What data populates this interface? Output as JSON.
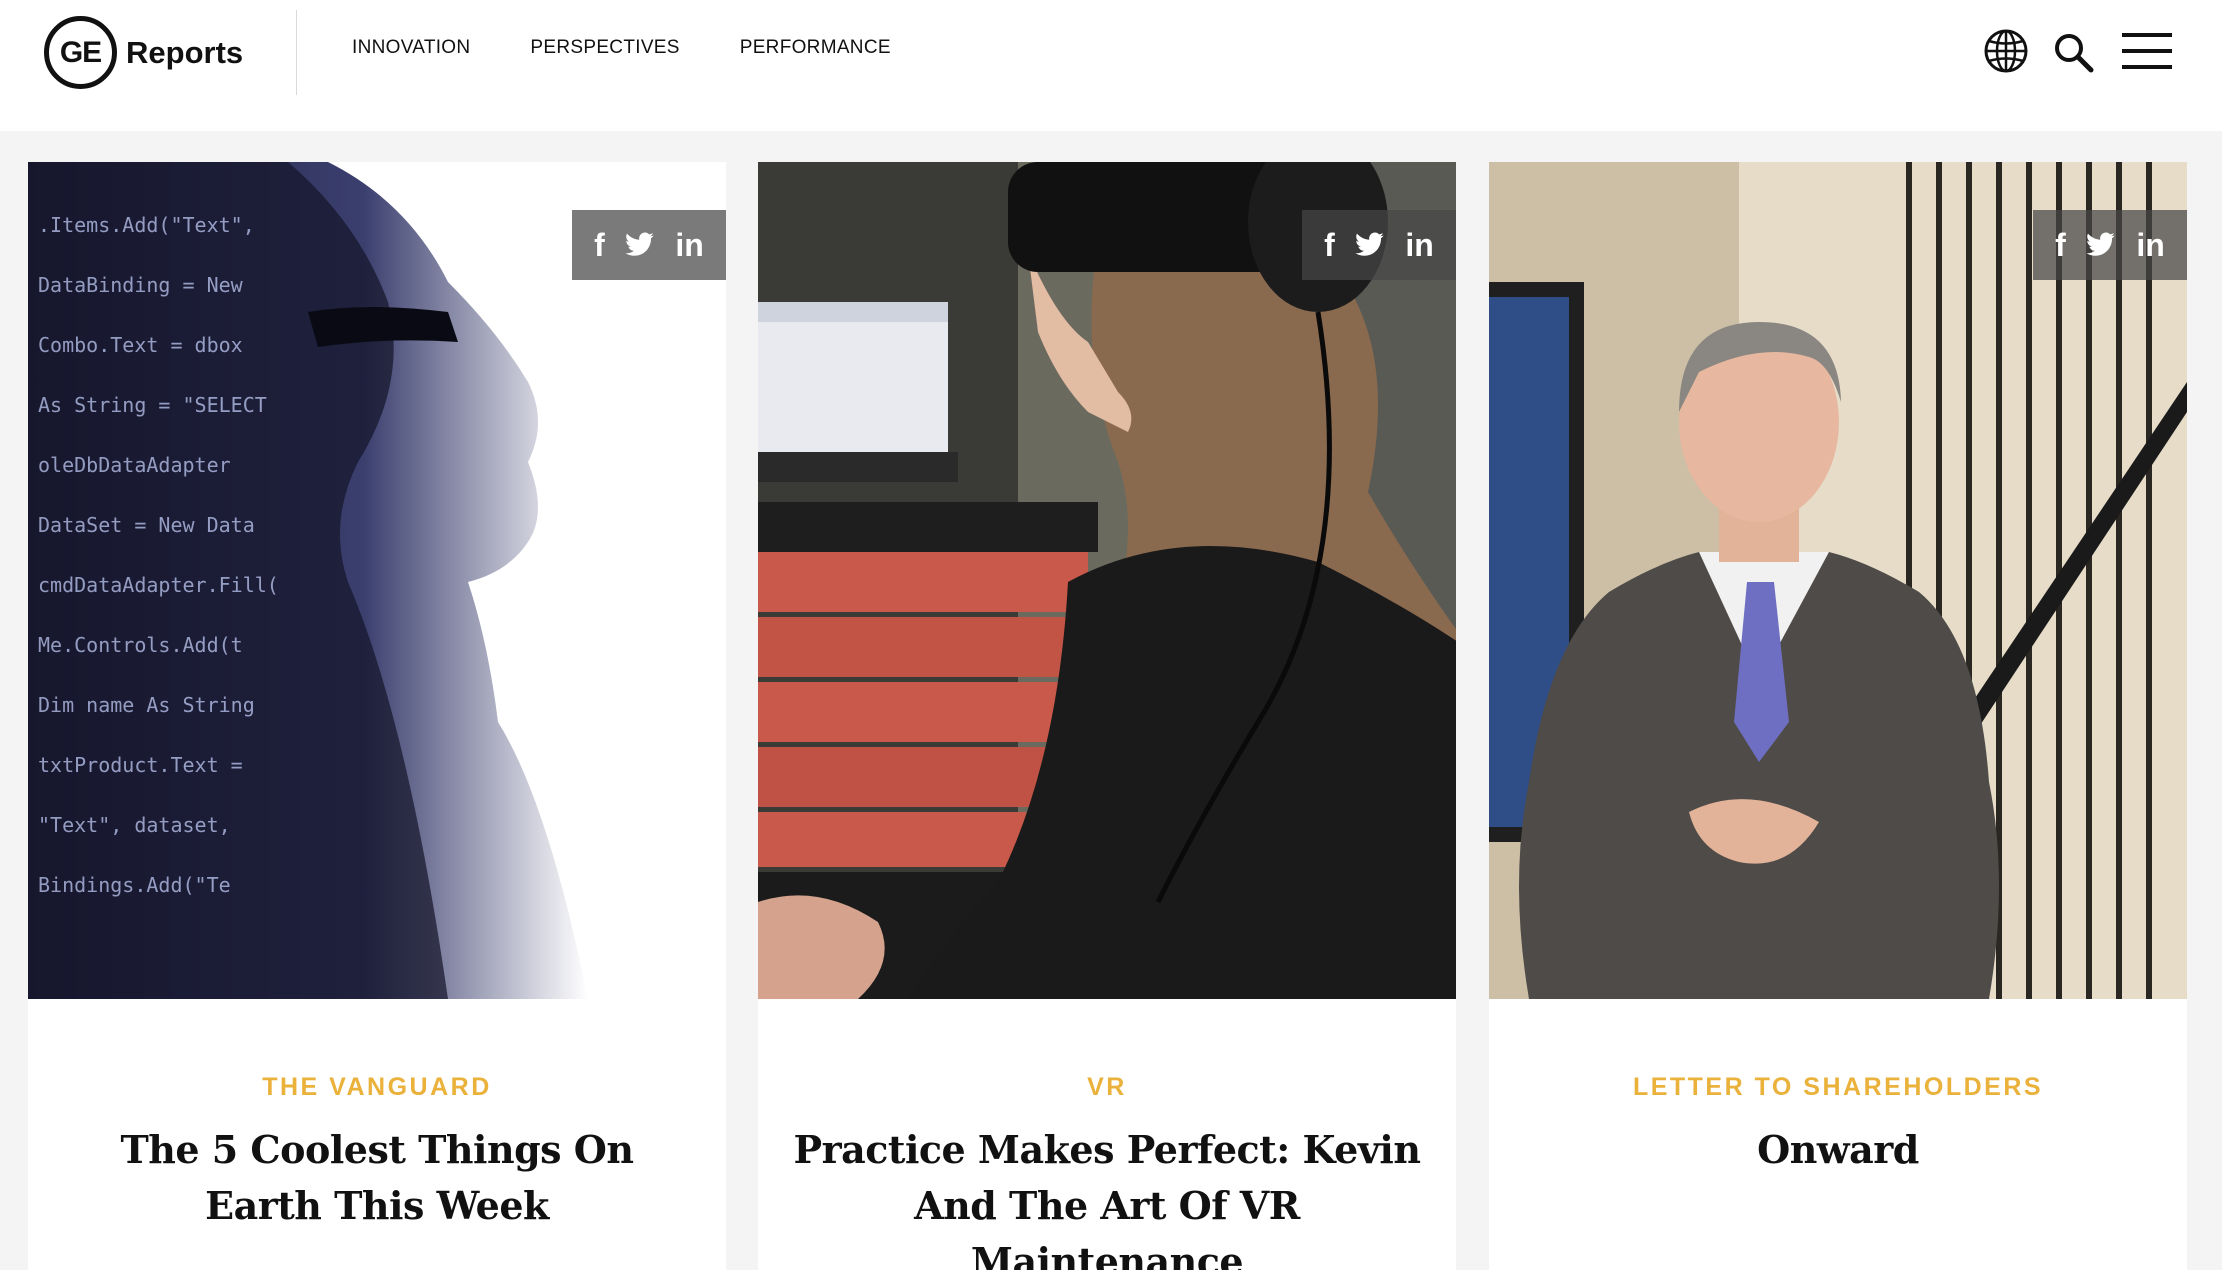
{
  "header": {
    "logo_mark": "GE",
    "logo_text": "Reports",
    "nav": [
      "INNOVATION",
      "PERSPECTIVES",
      "PERFORMANCE"
    ],
    "icons": [
      "globe-icon",
      "search-icon",
      "hamburger-menu-icon"
    ]
  },
  "share": {
    "facebook": "f",
    "linkedin": "in"
  },
  "cards": [
    {
      "category": "THE VANGUARD",
      "title": "The 5 Coolest Things On Earth This Week",
      "image": "woman-in-glasses-with-code-overlay"
    },
    {
      "category": "VR",
      "title": "Practice Makes Perfect: Kevin And The Art Of VR Maintenance",
      "image": "woman-wearing-vr-headset"
    },
    {
      "category": "LETTER TO SHAREHOLDERS",
      "title": "Onward",
      "image": "man-in-suit-portrait"
    }
  ],
  "colors": {
    "category": "#eab13b",
    "background": "#f4f4f4"
  }
}
